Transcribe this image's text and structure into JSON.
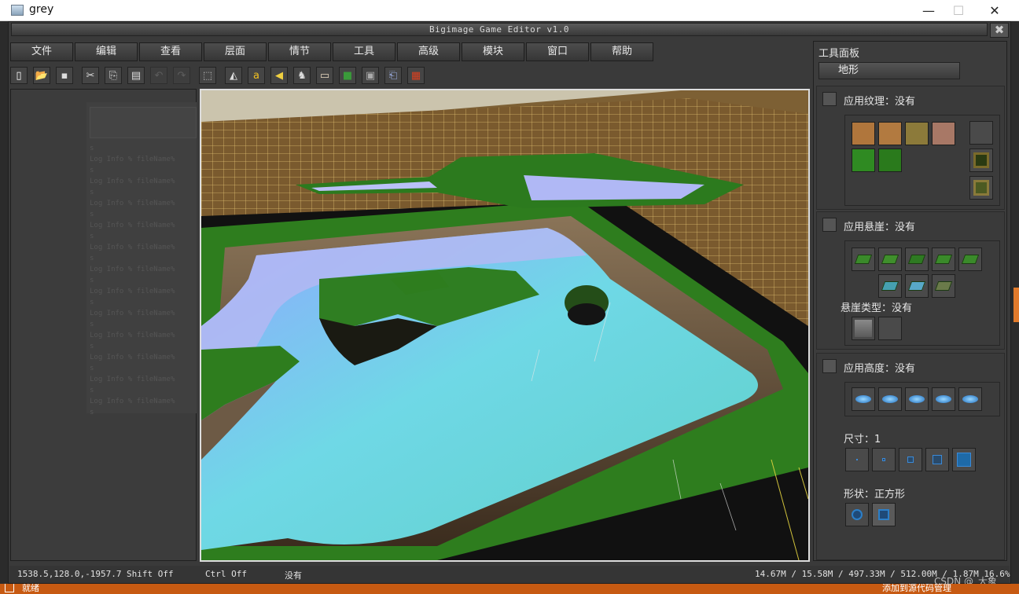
{
  "window": {
    "title": "grey",
    "minimize": "—",
    "maximize": "☐",
    "close": "✕"
  },
  "app": {
    "title": "Bigimage Game Editor v1.0",
    "close": "✖"
  },
  "menu": [
    "文件",
    "编辑",
    "查看",
    "层面",
    "情节",
    "工具",
    "高级",
    "模块",
    "窗口",
    "帮助"
  ],
  "toolbar_icons": [
    "new-icon",
    "open-icon",
    "save-icon",
    "cut-icon",
    "copy-icon",
    "paste-icon",
    "undo-icon",
    "redo-icon",
    "select-icon",
    "terrain-icon",
    "text-icon",
    "sound-icon",
    "unit-icon",
    "doodad-icon",
    "region-icon",
    "camera-icon",
    "import-icon",
    "trigger-icon"
  ],
  "log": {
    "lines": [
      "s",
      "Log Info  %  fileName%",
      "s",
      "Log Info  %  fileName%",
      "s",
      "Log Info  %  fileName%",
      "s",
      "Log Info  %  fileName%",
      "s",
      "Log Info  %  fileName%",
      "s",
      "Log Info  %  fileName%",
      "s",
      "Log Info  %  fileName%",
      "s",
      "Log Info  %  fileName%",
      "s",
      "Log Info  %  fileName%",
      "s",
      "Log Info  %  fileName%",
      "s",
      "Log Info  %  fileName%",
      "s",
      "Log Info  %  fileName%",
      "s"
    ]
  },
  "tool_panel": {
    "title": "工具面板",
    "tab": "地形",
    "texture": {
      "label": "应用纹理：没有",
      "swatches": [
        "#b0763c",
        "#b27a40",
        "#8c7a3a",
        "#a87866",
        "#2f8a22",
        "#2a7a1c"
      ],
      "side_buttons": [
        "blank-tile-icon",
        "tile-dark-icon",
        "tile-light-icon"
      ]
    },
    "cliff": {
      "label": "应用悬崖：没有",
      "type_label": "悬崖类型：没有"
    },
    "height": {
      "label": "应用高度：没有"
    },
    "size": {
      "label": "尺寸：1"
    },
    "shape": {
      "label": "形状：正方形"
    }
  },
  "status": {
    "coords": "1538.5,128.0,-1957.7",
    "shift": "Shift Off",
    "ctrl": "Ctrl Off",
    "selection": "没有",
    "memory": "14.67M / 15.58M / 497.33M / 512.00M / 1.87M   16.6%"
  },
  "taskbar": {
    "left": "就绪",
    "right": "添加到源代码管理"
  },
  "watermark": "CSDN @_大象_"
}
